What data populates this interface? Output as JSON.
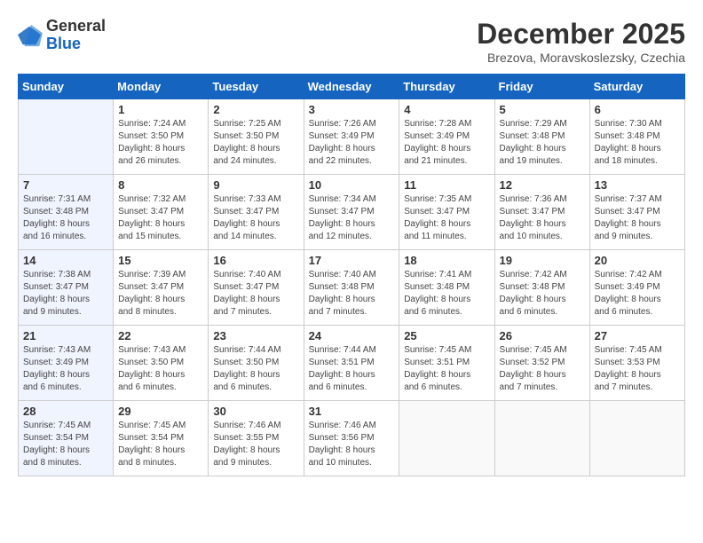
{
  "logo": {
    "general": "General",
    "blue": "Blue"
  },
  "title": "December 2025",
  "location": "Brezova, Moravskoslezsky, Czechia",
  "weekdays": [
    "Sunday",
    "Monday",
    "Tuesday",
    "Wednesday",
    "Thursday",
    "Friday",
    "Saturday"
  ],
  "weeks": [
    [
      {
        "day": "",
        "info": ""
      },
      {
        "day": "1",
        "info": "Sunrise: 7:24 AM\nSunset: 3:50 PM\nDaylight: 8 hours\nand 26 minutes."
      },
      {
        "day": "2",
        "info": "Sunrise: 7:25 AM\nSunset: 3:50 PM\nDaylight: 8 hours\nand 24 minutes."
      },
      {
        "day": "3",
        "info": "Sunrise: 7:26 AM\nSunset: 3:49 PM\nDaylight: 8 hours\nand 22 minutes."
      },
      {
        "day": "4",
        "info": "Sunrise: 7:28 AM\nSunset: 3:49 PM\nDaylight: 8 hours\nand 21 minutes."
      },
      {
        "day": "5",
        "info": "Sunrise: 7:29 AM\nSunset: 3:48 PM\nDaylight: 8 hours\nand 19 minutes."
      },
      {
        "day": "6",
        "info": "Sunrise: 7:30 AM\nSunset: 3:48 PM\nDaylight: 8 hours\nand 18 minutes."
      }
    ],
    [
      {
        "day": "7",
        "info": "Sunrise: 7:31 AM\nSunset: 3:48 PM\nDaylight: 8 hours\nand 16 minutes."
      },
      {
        "day": "8",
        "info": "Sunrise: 7:32 AM\nSunset: 3:47 PM\nDaylight: 8 hours\nand 15 minutes."
      },
      {
        "day": "9",
        "info": "Sunrise: 7:33 AM\nSunset: 3:47 PM\nDaylight: 8 hours\nand 14 minutes."
      },
      {
        "day": "10",
        "info": "Sunrise: 7:34 AM\nSunset: 3:47 PM\nDaylight: 8 hours\nand 12 minutes."
      },
      {
        "day": "11",
        "info": "Sunrise: 7:35 AM\nSunset: 3:47 PM\nDaylight: 8 hours\nand 11 minutes."
      },
      {
        "day": "12",
        "info": "Sunrise: 7:36 AM\nSunset: 3:47 PM\nDaylight: 8 hours\nand 10 minutes."
      },
      {
        "day": "13",
        "info": "Sunrise: 7:37 AM\nSunset: 3:47 PM\nDaylight: 8 hours\nand 9 minutes."
      }
    ],
    [
      {
        "day": "14",
        "info": "Sunrise: 7:38 AM\nSunset: 3:47 PM\nDaylight: 8 hours\nand 9 minutes."
      },
      {
        "day": "15",
        "info": "Sunrise: 7:39 AM\nSunset: 3:47 PM\nDaylight: 8 hours\nand 8 minutes."
      },
      {
        "day": "16",
        "info": "Sunrise: 7:40 AM\nSunset: 3:47 PM\nDaylight: 8 hours\nand 7 minutes."
      },
      {
        "day": "17",
        "info": "Sunrise: 7:40 AM\nSunset: 3:48 PM\nDaylight: 8 hours\nand 7 minutes."
      },
      {
        "day": "18",
        "info": "Sunrise: 7:41 AM\nSunset: 3:48 PM\nDaylight: 8 hours\nand 6 minutes."
      },
      {
        "day": "19",
        "info": "Sunrise: 7:42 AM\nSunset: 3:48 PM\nDaylight: 8 hours\nand 6 minutes."
      },
      {
        "day": "20",
        "info": "Sunrise: 7:42 AM\nSunset: 3:49 PM\nDaylight: 8 hours\nand 6 minutes."
      }
    ],
    [
      {
        "day": "21",
        "info": "Sunrise: 7:43 AM\nSunset: 3:49 PM\nDaylight: 8 hours\nand 6 minutes."
      },
      {
        "day": "22",
        "info": "Sunrise: 7:43 AM\nSunset: 3:50 PM\nDaylight: 8 hours\nand 6 minutes."
      },
      {
        "day": "23",
        "info": "Sunrise: 7:44 AM\nSunset: 3:50 PM\nDaylight: 8 hours\nand 6 minutes."
      },
      {
        "day": "24",
        "info": "Sunrise: 7:44 AM\nSunset: 3:51 PM\nDaylight: 8 hours\nand 6 minutes."
      },
      {
        "day": "25",
        "info": "Sunrise: 7:45 AM\nSunset: 3:51 PM\nDaylight: 8 hours\nand 6 minutes."
      },
      {
        "day": "26",
        "info": "Sunrise: 7:45 AM\nSunset: 3:52 PM\nDaylight: 8 hours\nand 7 minutes."
      },
      {
        "day": "27",
        "info": "Sunrise: 7:45 AM\nSunset: 3:53 PM\nDaylight: 8 hours\nand 7 minutes."
      }
    ],
    [
      {
        "day": "28",
        "info": "Sunrise: 7:45 AM\nSunset: 3:54 PM\nDaylight: 8 hours\nand 8 minutes."
      },
      {
        "day": "29",
        "info": "Sunrise: 7:45 AM\nSunset: 3:54 PM\nDaylight: 8 hours\nand 8 minutes."
      },
      {
        "day": "30",
        "info": "Sunrise: 7:46 AM\nSunset: 3:55 PM\nDaylight: 8 hours\nand 9 minutes."
      },
      {
        "day": "31",
        "info": "Sunrise: 7:46 AM\nSunset: 3:56 PM\nDaylight: 8 hours\nand 10 minutes."
      },
      {
        "day": "",
        "info": ""
      },
      {
        "day": "",
        "info": ""
      },
      {
        "day": "",
        "info": ""
      }
    ]
  ]
}
